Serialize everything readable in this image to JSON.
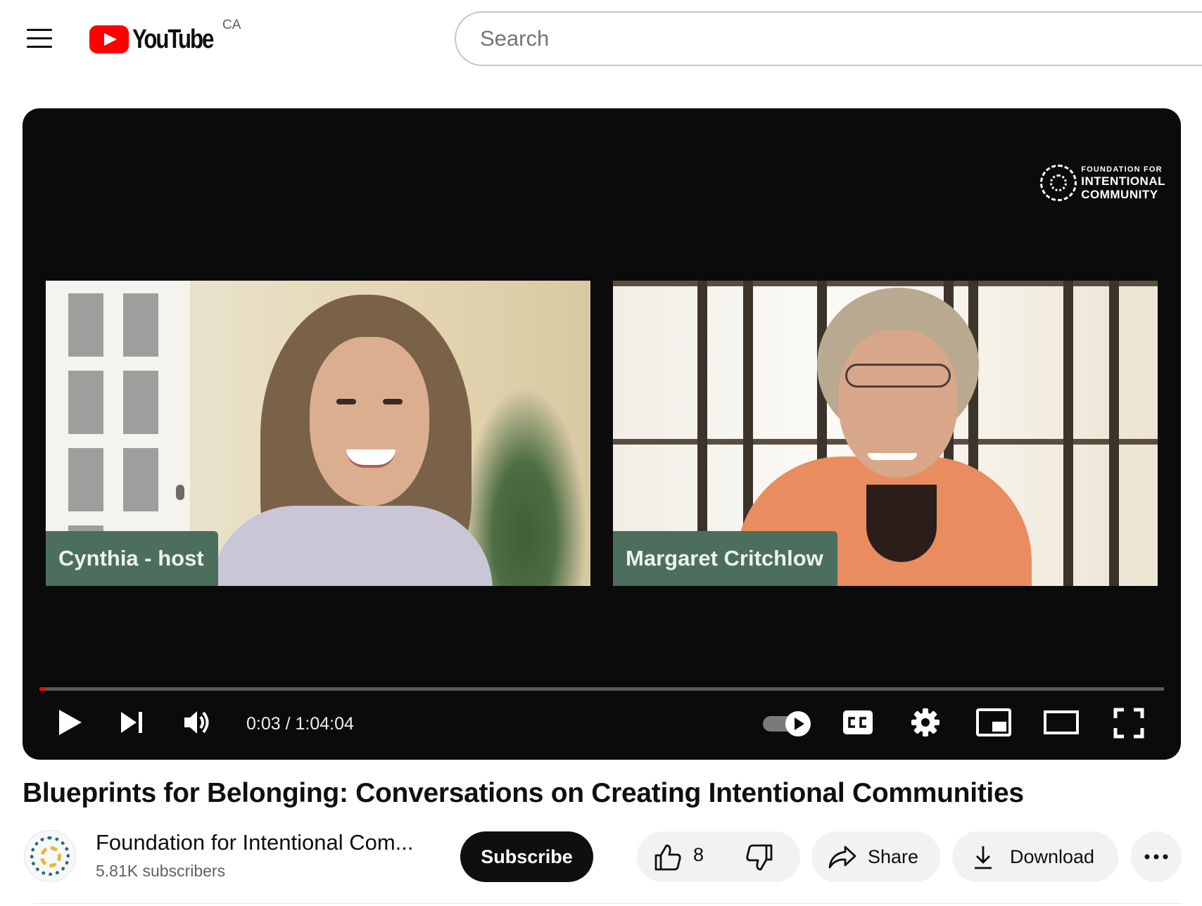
{
  "header": {
    "logo_text": "YouTube",
    "country_code": "CA",
    "search_placeholder": "Search"
  },
  "player": {
    "channel_watermark": {
      "line1": "FOUNDATION FOR",
      "line2": "INTENTIONAL",
      "line3": "COMMUNITY"
    },
    "participants": [
      {
        "name": "Cynthia - host"
      },
      {
        "name": "Margaret Critchlow"
      }
    ],
    "time_current": "0:03",
    "time_total": "1:04:04",
    "time_display": "0:03 / 1:04:04",
    "progress_fraction": 0.0008,
    "autoplay_on": true,
    "controls": [
      "play-icon",
      "next-icon",
      "volume-icon",
      "autoplay-toggle",
      "cc-icon",
      "settings-icon",
      "miniplayer-icon",
      "theater-icon",
      "fullscreen-icon"
    ]
  },
  "video": {
    "title": "Blueprints for Belonging: Conversations on Creating Intentional Communities"
  },
  "channel": {
    "name": "Foundation for Intentional Com...",
    "subscribers": "5.81K subscribers",
    "subscribe_label": "Subscribe"
  },
  "actions": {
    "like_count": "8",
    "share_label": "Share",
    "download_label": "Download"
  },
  "colors": {
    "brand_red": "#ff0000",
    "name_tag_green": "#4b6f5c",
    "player_bg": "#0b0b0c",
    "pill_bg": "#f2f2f2"
  }
}
